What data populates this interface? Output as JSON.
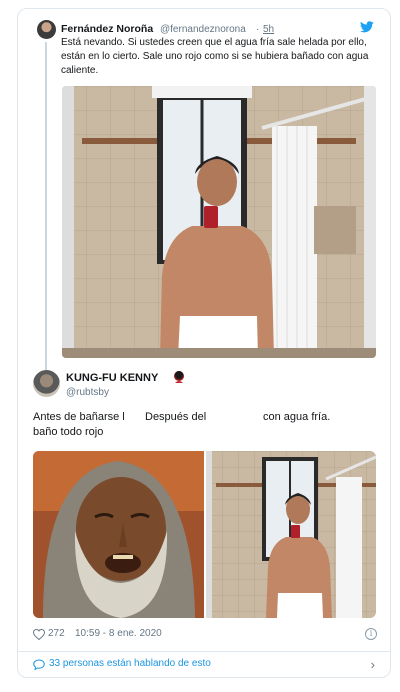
{
  "quoted_tweet": {
    "author_name": "Fernández Noroña",
    "handle": "@fernandeznorona",
    "separator": "·",
    "time": "5h",
    "text": "Está nevando. Si ustedes creen que el agua fría sale helada por ello, están en lo cierto. Sale uno rojo como si se hubiera bañado con agua caliente.",
    "photo_icon": "bathroom-mirror-selfie-photo"
  },
  "reply_tweet": {
    "author_name": "KUNG-FU KENNY",
    "handle": "@rubtsby",
    "author_emoji": "red-face-emoji",
    "caption_left": "Antes de bañarse l baño todo rojo",
    "caption_middle": "Después del",
    "caption_right": "con agua fría.",
    "photos": [
      "weathered-old-man-photo",
      "bathroom-mirror-selfie-photo"
    ]
  },
  "meta": {
    "likes": "272",
    "timestamp": "10:59 - 8 ene. 2020",
    "info_icon": "i"
  },
  "footer": {
    "talking_text": "33 personas están hablando de esto"
  },
  "colors": {
    "accent": "#1b95e0",
    "text": "#14171a",
    "muted": "#657786",
    "border": "#e1e8ed"
  }
}
